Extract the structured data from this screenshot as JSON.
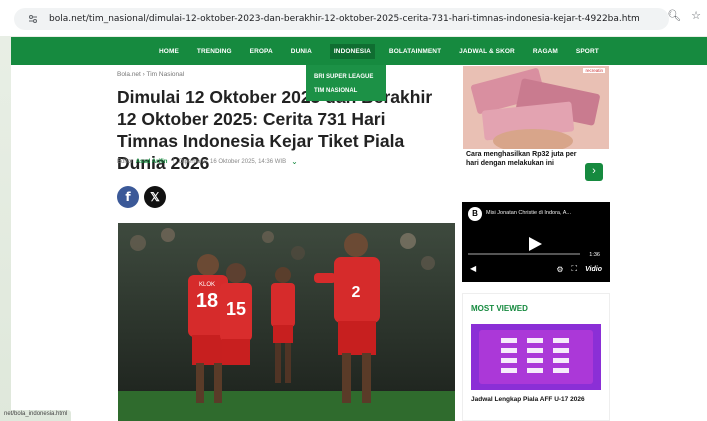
{
  "browser": {
    "url": "bola.net/tim_nasional/dimulai-12-oktober-2023-dan-berakhir-12-oktober-2025-cerita-731-hari-timnas-indonesia-kejar-t-4922ba.html",
    "status_url": "net/bola_indonesia.html"
  },
  "nav": {
    "items": [
      "HOME",
      "TRENDING",
      "EROPA",
      "DUNIA",
      "INDONESIA",
      "BOLATAINMENT",
      "JADWAL & SKOR",
      "RAGAM",
      "SPORT"
    ],
    "dropdown": [
      "BRI SUPER LEAGUE",
      "TIM NASIONAL"
    ]
  },
  "article": {
    "breadcrumb": "Bola.net › Tim Nasional",
    "title": "Dimulai 12 Oktober 2023 dan Berakhir 12 Oktober 2025: Cerita 731 Hari Timnas Indonesia Kejar Tiket Piala Dunia 2026",
    "editor_label": "Editor",
    "editor_name": "Asad Arifin",
    "updated": "Diperbarui: 16 Oktober 2025, 14:36 WIB"
  },
  "ad": {
    "text": "Cara menghasilkan Rp32 juta per hari dengan melakukan ini",
    "badge": "recreatin"
  },
  "video": {
    "title": "Misi Jonatan Christie di Indora, A...",
    "time": "1:36",
    "brand": "Vidio"
  },
  "most_viewed": {
    "heading": "MOST VIEWED",
    "caption": "Jadwal Lengkap Piala AFF U-17 2026"
  },
  "hero": {
    "players": [
      "KLOK 18",
      "15",
      "2"
    ]
  },
  "colors": {
    "brand_green": "#168a3f"
  }
}
